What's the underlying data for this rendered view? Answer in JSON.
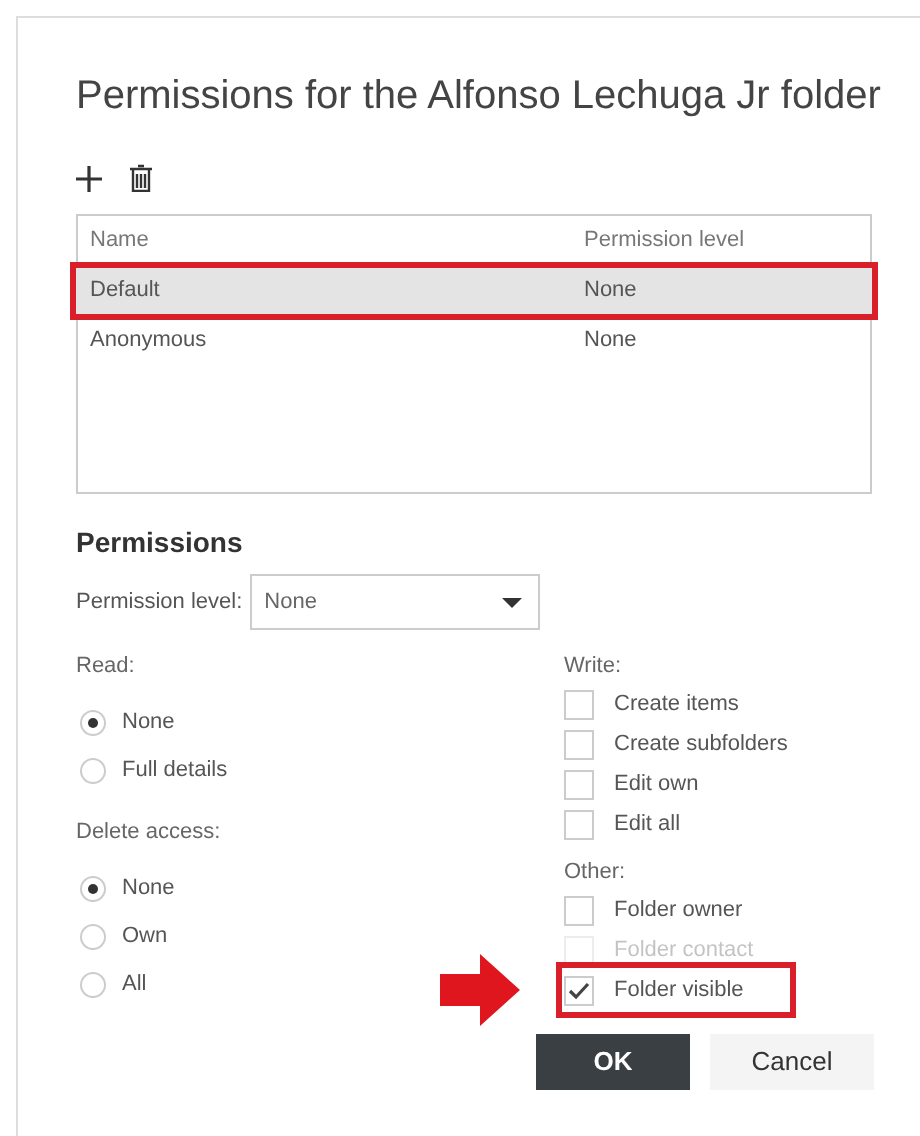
{
  "title": "Permissions for the Alfonso Lechuga Jr folder",
  "table": {
    "columns": [
      "Name",
      "Permission level"
    ],
    "rows": [
      {
        "cells": [
          "Default",
          "None"
        ],
        "selected": true,
        "highlighted": true
      },
      {
        "cells": [
          "Anonymous",
          "None"
        ],
        "selected": false,
        "highlighted": false
      }
    ]
  },
  "permissions": {
    "heading": "Permissions",
    "level_label": "Permission level:",
    "level_value": "None",
    "read": {
      "label": "Read:",
      "options": [
        {
          "label": "None",
          "selected": true
        },
        {
          "label": "Full details",
          "selected": false
        }
      ]
    },
    "delete_access": {
      "label": "Delete access:",
      "options": [
        {
          "label": "None",
          "selected": true
        },
        {
          "label": "Own",
          "selected": false
        },
        {
          "label": "All",
          "selected": false
        }
      ]
    },
    "write": {
      "label": "Write:",
      "options": [
        {
          "label": "Create items",
          "checked": false,
          "disabled": false,
          "highlighted": false
        },
        {
          "label": "Create subfolders",
          "checked": false,
          "disabled": false,
          "highlighted": false
        },
        {
          "label": "Edit own",
          "checked": false,
          "disabled": false,
          "highlighted": false
        },
        {
          "label": "Edit all",
          "checked": false,
          "disabled": false,
          "highlighted": false
        }
      ]
    },
    "other": {
      "label": "Other:",
      "options": [
        {
          "label": "Folder owner",
          "checked": false,
          "disabled": false,
          "highlighted": false
        },
        {
          "label": "Folder contact",
          "checked": false,
          "disabled": true,
          "highlighted": false
        },
        {
          "label": "Folder visible",
          "checked": true,
          "disabled": false,
          "highlighted": true
        }
      ]
    }
  },
  "buttons": [
    {
      "label": "OK",
      "kind": "primary"
    },
    {
      "label": "Cancel",
      "kind": "secondary"
    }
  ]
}
